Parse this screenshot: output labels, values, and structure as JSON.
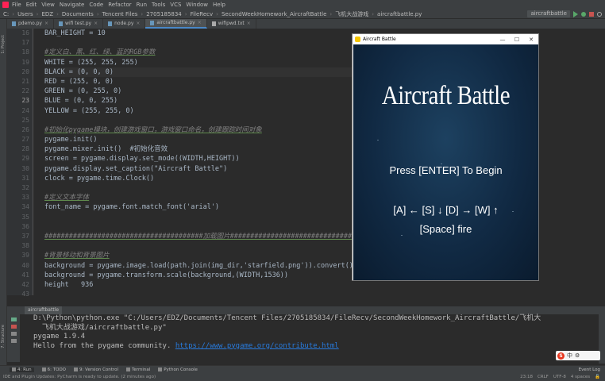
{
  "menu": [
    "File",
    "Edit",
    "View",
    "Navigate",
    "Code",
    "Refactor",
    "Run",
    "Tools",
    "VCS",
    "Window",
    "Help"
  ],
  "breadcrumb": [
    "C:",
    "Users",
    "EDZ",
    "Documents",
    "Tencent Files",
    "2705185834",
    "FileRecv",
    "SecondWeekHomework_AircraftBattle",
    "飞机大战游戏",
    "aircraftbattle.py"
  ],
  "run_config": "aircraftbattle",
  "tabs": [
    {
      "label": "pdemo.py"
    },
    {
      "label": "wifi test.py"
    },
    {
      "label": "node.py"
    },
    {
      "label": "aircraftbattle.py",
      "active": true
    },
    {
      "label": "wifipwd.txt"
    }
  ],
  "gutter": {
    "lines": [
      "16",
      "17",
      "18",
      "19",
      "20",
      "21",
      "22",
      "23",
      "24",
      "25",
      "26",
      "27",
      "28",
      "29",
      "30",
      "31",
      "32",
      "33",
      "34",
      "35",
      "36",
      "37",
      "38",
      "39",
      "40",
      "41",
      "42",
      "43"
    ],
    "current": "23"
  },
  "code_lines": [
    "BAR_HEIGHT = 10",
    "",
    "#定义白、黑、红、绿、蓝的RGB参数",
    "WHITE = (255, 255, 255)",
    "BLACK = (0, 0, 0)",
    "RED = (255, 0, 0)",
    "GREEN = (0, 255, 0)",
    "BLUE = (0, 0, 255)",
    "YELLOW = (255, 255, 0)",
    "",
    "#初始化pygame模块，创建游戏窗口，游戏窗口命名，创建跟踪时间对象",
    "pygame.init()",
    "pygame.mixer.init()  #初始化音效",
    "screen = pygame.display.set_mode((WIDTH,HEIGHT))",
    "pygame.display.set_caption(\"Aircraft Battle\")",
    "clock = pygame.time.Clock()",
    "",
    "#定义文本字体",
    "font_name = pygame.font.match_font('arial')",
    "",
    "",
    "#######################################加载图片#######################################",
    "",
    "#背景移动和背景图片",
    "background = pygame.image.load(path.join(img_dir,'starfield.png')).convert()",
    "background = pygame.transform.scale(background,(WIDTH,1536))",
    "height   936",
    ""
  ],
  "game_window": {
    "title": "Aircraft Battle",
    "controls": [
      "—",
      "☐",
      "✕"
    ],
    "heading": "Aircraft Battle",
    "line1": "Press [ENTER] To Begin",
    "line2": "[A] ← [S] ↓ [D] → [W] ↑",
    "line3": "[Space] fire"
  },
  "run_panel": {
    "tab": "aircraftbattle",
    "console": [
      "D:\\Python\\python.exe \"C:/Users/EDZ/Documents/Tencent Files/2705185834/FileRecv/SecondWeekHomework_AircraftBattle/飞机大",
      "  飞机大战游戏/aircraftbattle.py\"",
      "pygame 1.9.4",
      "Hello from the pygame community. "
    ],
    "link": "https://www.pygame.org/contribute.html"
  },
  "tool_windows": [
    "4: Run",
    "6: TODO",
    "9: Version Control",
    "Terminal",
    "Python Console"
  ],
  "event_log": "Event Log",
  "status": {
    "message": "IDE and Plugin Updates: PyCharm is ready to update. (2 minutes ago)",
    "position": "23:18",
    "line_sep": "CRLF",
    "encoding": "UTF-8",
    "indent": "4 spaces"
  },
  "ime": {
    "label": "中"
  },
  "colors": {
    "accent": "#4a88c7",
    "editor_bg": "#2b2b2b",
    "game_bg": "#112a44"
  }
}
